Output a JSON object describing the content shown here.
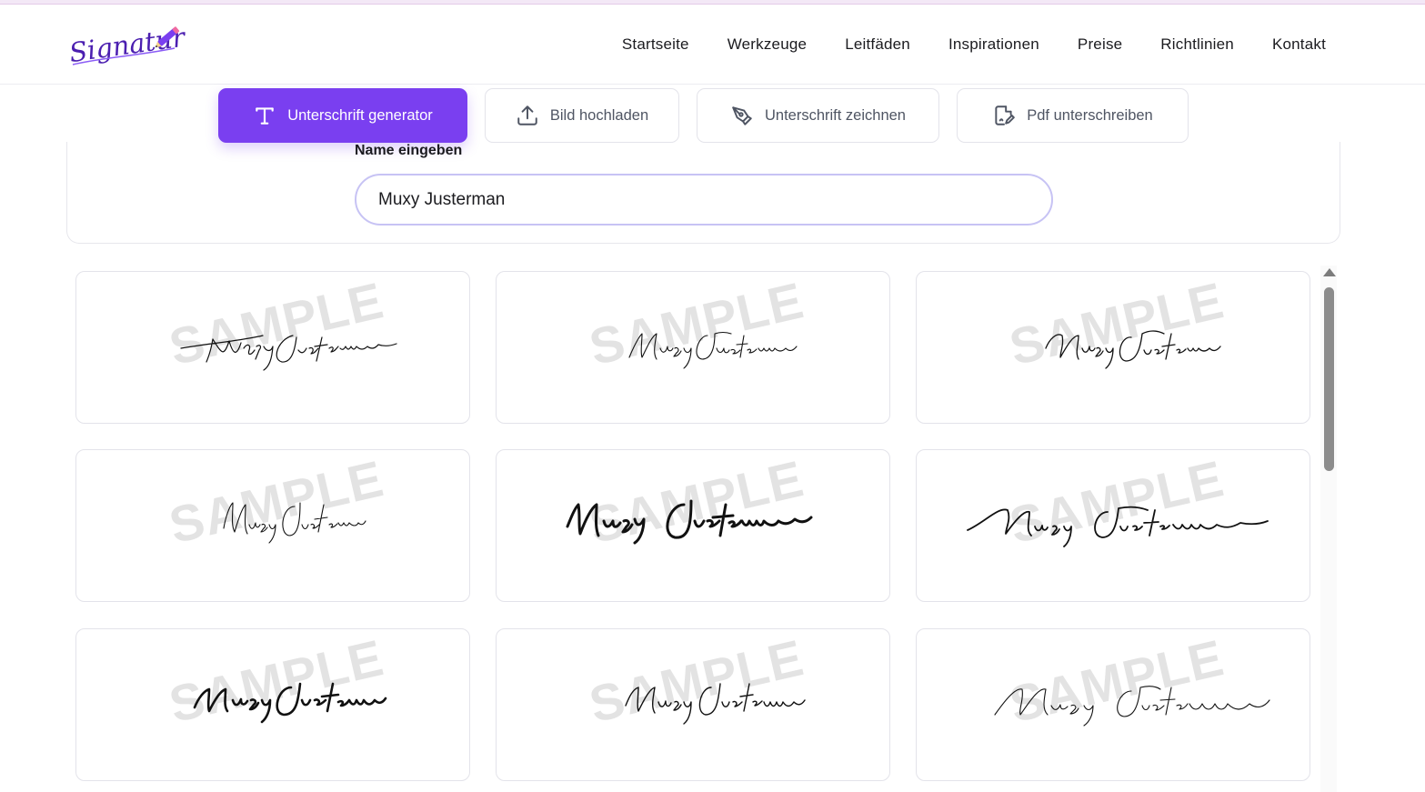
{
  "brand": {
    "logo_text": "Signature",
    "accent_color": "#7a3ff0"
  },
  "nav": {
    "items": [
      {
        "label": "Startseite"
      },
      {
        "label": "Werkzeuge"
      },
      {
        "label": "Leitfäden"
      },
      {
        "label": "Inspirationen"
      },
      {
        "label": "Preise"
      },
      {
        "label": "Richtlinien"
      },
      {
        "label": "Kontakt"
      }
    ]
  },
  "tabs": [
    {
      "label": "Unterschrift generator",
      "icon": "text-t-icon",
      "active": true
    },
    {
      "label": "Bild hochladen",
      "icon": "upload-icon",
      "active": false
    },
    {
      "label": "Unterschrift zeichnen",
      "icon": "pen-nib-icon",
      "active": false
    },
    {
      "label": "Pdf unterschreiben",
      "icon": "document-sign-icon",
      "active": false
    }
  ],
  "name_field": {
    "label": "Name eingeben",
    "value": "Muxy Justerman"
  },
  "signatures": {
    "watermark": "SAMPLE",
    "items": [
      {
        "style": "thin-flourish"
      },
      {
        "style": "light-script"
      },
      {
        "style": "loose-script"
      },
      {
        "style": "compact-script"
      },
      {
        "style": "bold-brush"
      },
      {
        "style": "long-stroke"
      },
      {
        "style": "bold-italic"
      },
      {
        "style": "fine-italic"
      },
      {
        "style": "wide-loops"
      }
    ]
  }
}
